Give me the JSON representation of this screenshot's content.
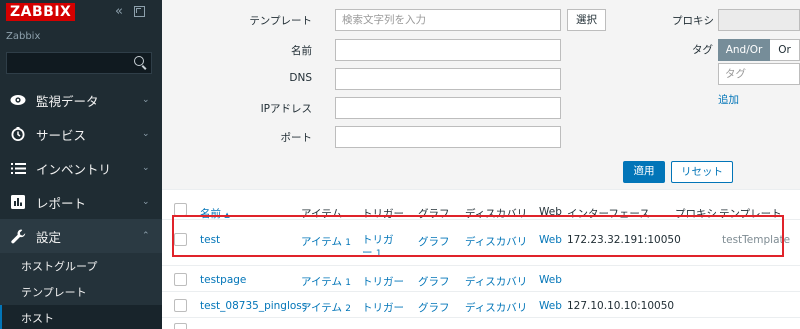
{
  "sidebar": {
    "logo": "ZABBIX",
    "collapse_glyph": "«",
    "server_name": "Zabbix",
    "search_placeholder": "",
    "menu": [
      {
        "label": "監視データ",
        "icon": "eye-icon",
        "chevron": "⌄"
      },
      {
        "label": "サービス",
        "icon": "clock-icon",
        "chevron": "⌄"
      },
      {
        "label": "インベントリ",
        "icon": "list-icon",
        "chevron": "⌄"
      },
      {
        "label": "レポート",
        "icon": "report-icon",
        "chevron": "⌄"
      },
      {
        "label": "設定",
        "icon": "wrench-icon",
        "chevron": "⌃"
      }
    ],
    "submenu": [
      "ホストグループ",
      "テンプレート",
      "ホスト"
    ],
    "active_submenu": "ホスト"
  },
  "filter": {
    "template_label": "テンプレート",
    "template_placeholder": "検索文字列を入力",
    "select_button": "選択",
    "name_label": "名前",
    "dns_label": "DNS",
    "ip_label": "IPアドレス",
    "port_label": "ポート",
    "proxy_label": "プロキシ",
    "tag_label": "タグ",
    "andor_label": "And/Or",
    "or_label": "Or",
    "tag_placeholder": "タグ",
    "add_link": "追加",
    "apply_button": "適用",
    "reset_button": "リセット"
  },
  "table": {
    "headers": {
      "name": "名前",
      "sort_arrow": "▲",
      "items": "アイテム",
      "triggers": "トリガー",
      "graphs": "グラフ",
      "discovery": "ディスカバリ",
      "web": "Web",
      "interface": "インターフェース",
      "proxy": "プロキシ",
      "templates": "テンプレート"
    },
    "rows": [
      {
        "name": "test",
        "items": "アイテム",
        "items_count": "1",
        "triggers_line1": "トリガ",
        "triggers_line2": "ー",
        "triggers_count": "1",
        "graphs": "グラフ",
        "discovery": "ディスカバリ",
        "web": "Web",
        "interface": "172.23.32.191:10050",
        "templates": "testTemplate"
      },
      {
        "name": "testpage",
        "items": "アイテム",
        "items_count": "1",
        "triggers": "トリガー",
        "graphs": "グラフ",
        "discovery": "ディスカバリ",
        "web": "Web",
        "interface": ""
      },
      {
        "name": "test_08735_pingloss",
        "items": "アイテム",
        "items_count": "2",
        "triggers": "トリガー",
        "graphs": "グラフ",
        "discovery": "ディスカバリ",
        "web": "Web",
        "interface": "127.10.10.10:10050"
      }
    ]
  },
  "colors": {
    "sidebar_bg": "#1f2c33",
    "logo_red": "#d40000",
    "link_blue": "#0275b8",
    "highlight_red": "#e0232a",
    "toggle_grey": "#768d99"
  }
}
